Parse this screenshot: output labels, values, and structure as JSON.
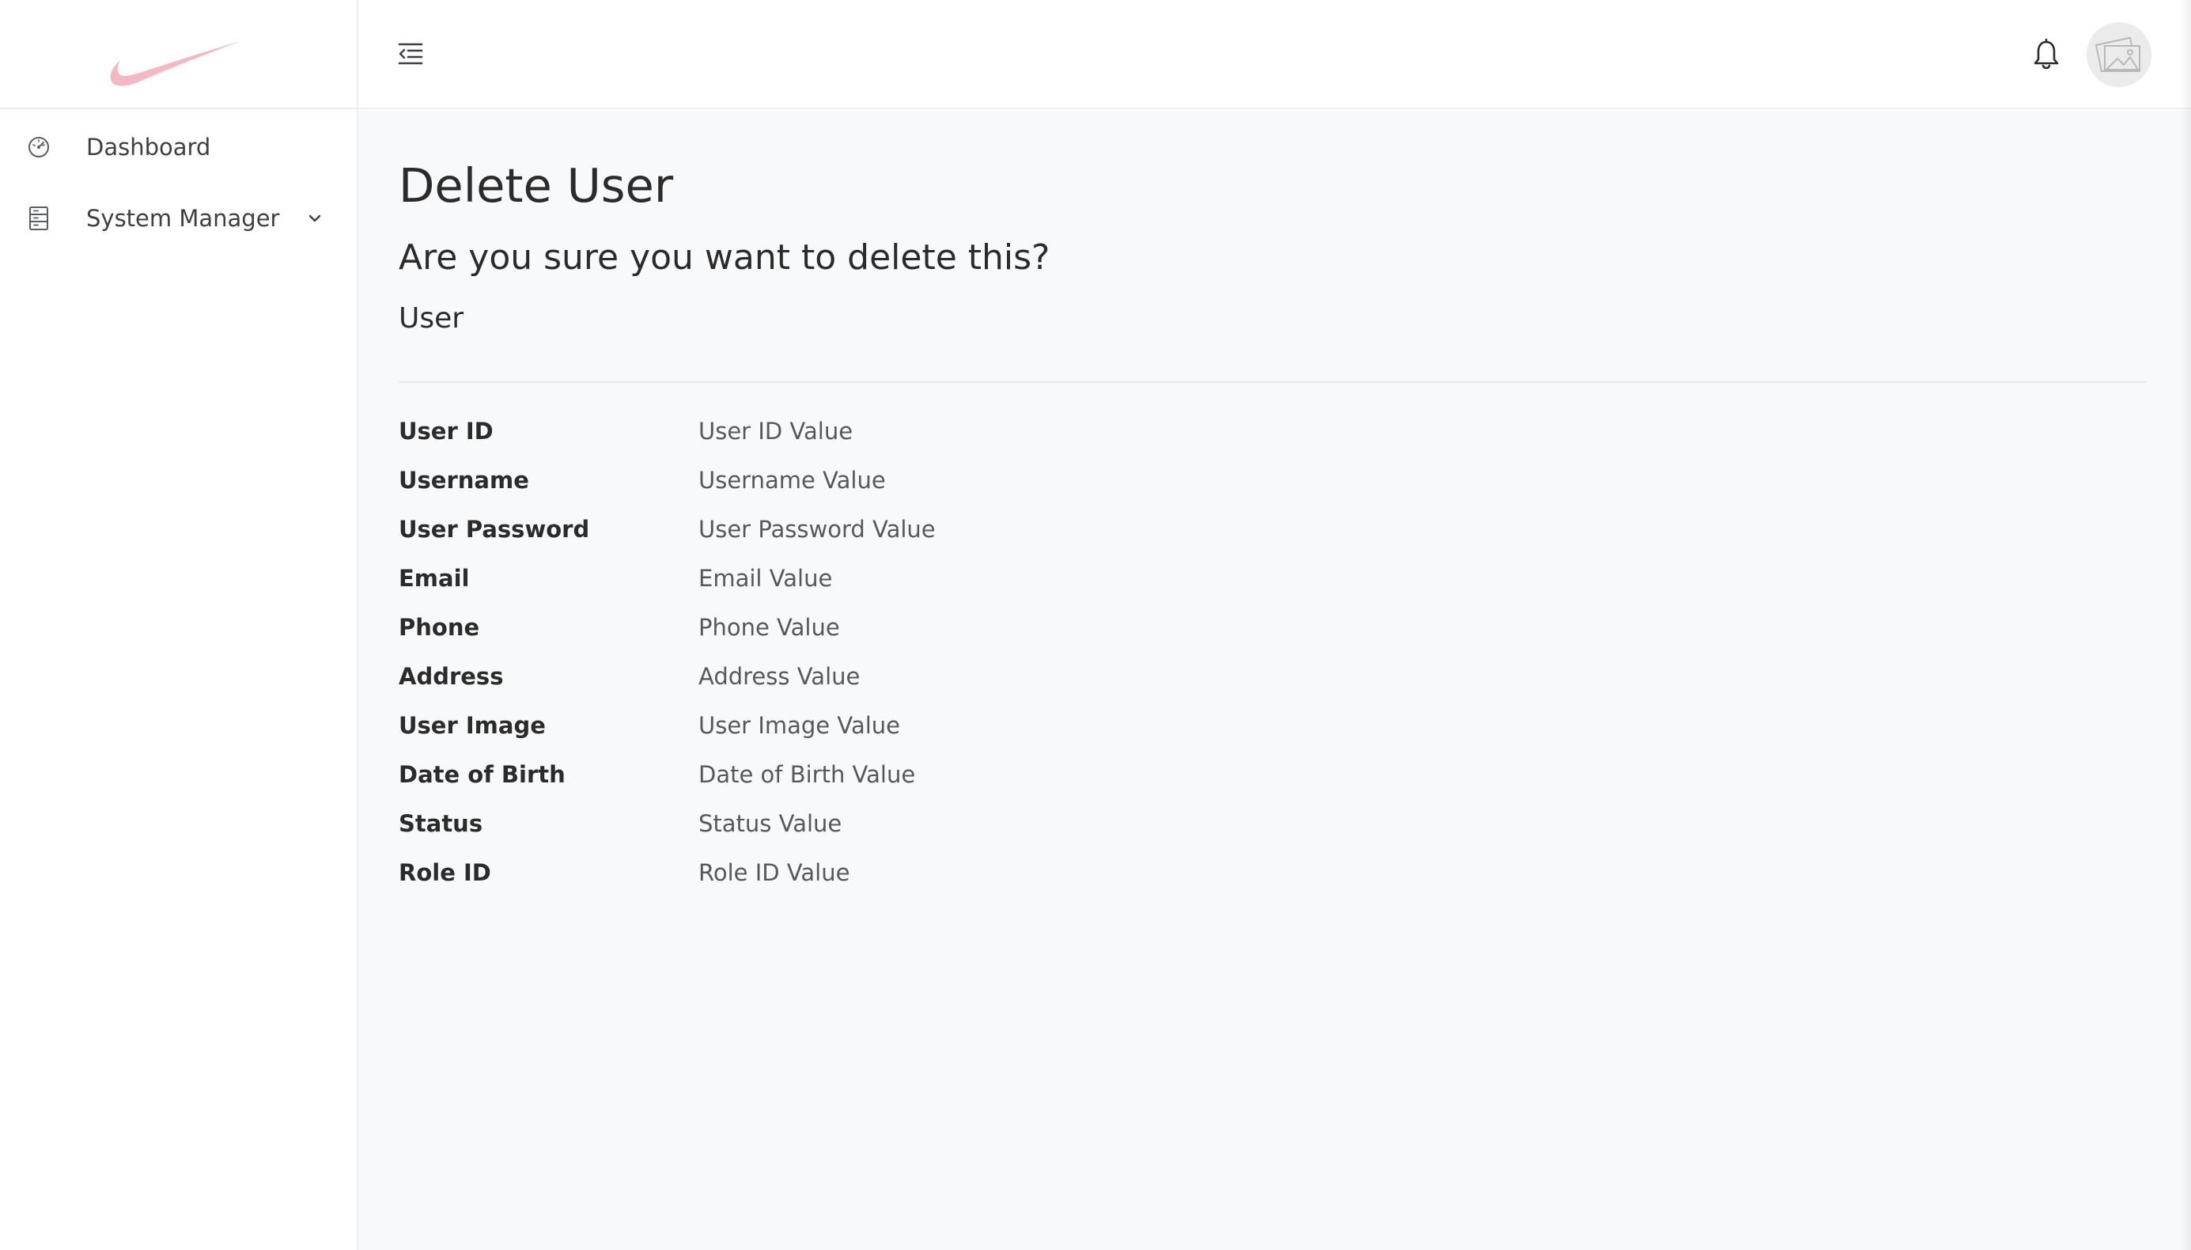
{
  "sidebar": {
    "logo_name": "swoosh-logo",
    "items": [
      {
        "label": "Dashboard",
        "icon": "dashboard-gauge-icon"
      },
      {
        "label": "System Manager",
        "icon": "server-icon",
        "has_submenu": true
      }
    ]
  },
  "topbar": {
    "menu_icon": "menu-collapse-icon",
    "notification_icon": "bell-icon",
    "avatar_icon": "image-placeholder-icon"
  },
  "page": {
    "title": "Delete User",
    "confirm_text": "Are you sure you want to delete this?",
    "entity_name": "User",
    "fields": [
      {
        "label": "User ID",
        "value": "User ID Value"
      },
      {
        "label": "Username",
        "value": "Username Value"
      },
      {
        "label": "User Password",
        "value": "User Password Value"
      },
      {
        "label": "Email",
        "value": "Email Value"
      },
      {
        "label": "Phone",
        "value": "Phone Value"
      },
      {
        "label": "Address",
        "value": "Address Value"
      },
      {
        "label": "User Image",
        "value": "User Image Value"
      },
      {
        "label": "Date of Birth",
        "value": "Date of Birth Value"
      },
      {
        "label": "Status",
        "value": "Status Value"
      },
      {
        "label": "Role ID",
        "value": "Role ID Value"
      }
    ]
  },
  "colors": {
    "logo": "#f4b8c3",
    "background": "#f8f9fb",
    "text": "#2b2b2b",
    "muted_text": "#55585c"
  }
}
